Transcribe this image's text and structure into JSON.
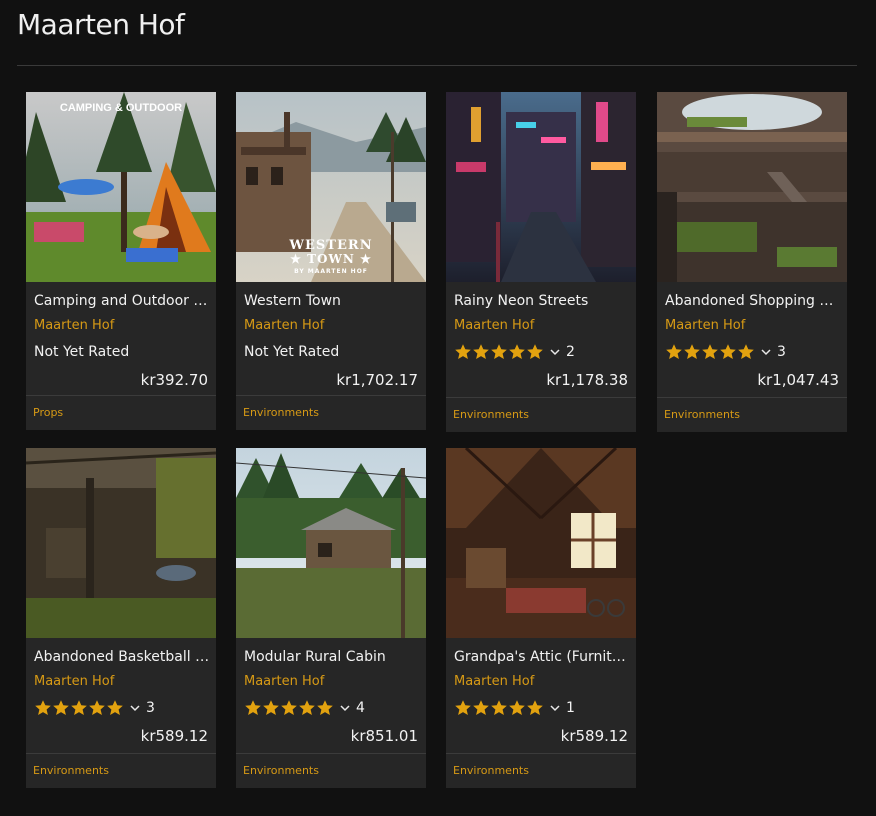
{
  "page": {
    "title": "Maarten Hof"
  },
  "products": [
    {
      "title": "Camping and Outdoor pr...",
      "author": "Maarten Hof",
      "rating_text": "Not Yet Rated",
      "stars": 0,
      "rating_count": "",
      "price": "kr392.70",
      "category": "Props",
      "image": "camping",
      "image_caption": "CAMPING & OUTDOOR"
    },
    {
      "title": "Western Town",
      "author": "Maarten Hof",
      "rating_text": "Not Yet Rated",
      "stars": 0,
      "rating_count": "",
      "price": "kr1,702.17",
      "category": "Environments",
      "image": "western",
      "image_caption": "WESTERN",
      "image_caption2": "★ TOWN ★",
      "image_caption3": "BY MAARTEN HOF"
    },
    {
      "title": "Rainy Neon Streets",
      "author": "Maarten Hof",
      "rating_text": "",
      "stars": 5,
      "rating_count": "2",
      "price": "kr1,178.38",
      "category": "Environments",
      "image": "neon"
    },
    {
      "title": "Abandoned Shopping Mall",
      "author": "Maarten Hof",
      "rating_text": "",
      "stars": 5,
      "rating_count": "3",
      "price": "kr1,047.43",
      "category": "Environments",
      "image": "mall"
    },
    {
      "title": "Abandoned Basketball C...",
      "author": "Maarten Hof",
      "rating_text": "",
      "stars": 5,
      "rating_count": "3",
      "price": "kr589.12",
      "category": "Environments",
      "image": "basketball"
    },
    {
      "title": "Modular Rural Cabin",
      "author": "Maarten Hof",
      "rating_text": "",
      "stars": 5,
      "rating_count": "4",
      "price": "kr851.01",
      "category": "Environments",
      "image": "cabin"
    },
    {
      "title": "Grandpa's Attic (Furnitur...",
      "author": "Maarten Hof",
      "rating_text": "",
      "stars": 5,
      "rating_count": "1",
      "price": "kr589.12",
      "category": "Environments",
      "image": "attic"
    }
  ],
  "colors": {
    "accent": "#d79a15",
    "star": "#e2a20f",
    "card": "#262626",
    "background": "#111111"
  },
  "icons": {
    "star": "star-icon",
    "chevron": "chevron-down-icon"
  }
}
